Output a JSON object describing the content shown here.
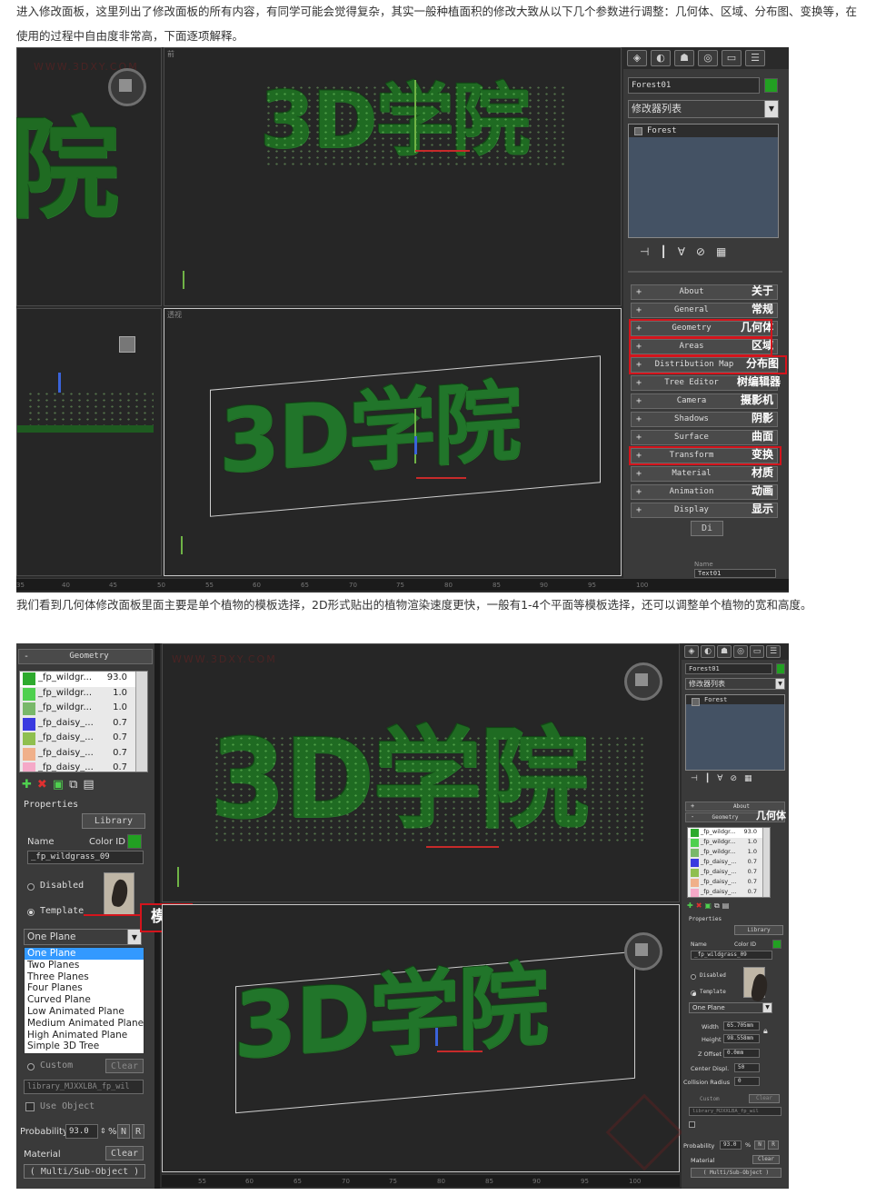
{
  "intro_text": "进入修改面板，这里列出了修改面板的所有内容，有同学可能会觉得复杂，其实一般种植面积的修改大致从以下几个参数进行调整：几何体、区域、分布图、变换等，在使用的过程中自由度非常高，下面逐项解释。",
  "middle_text": "我们看到几何体修改面板里面主要是单个植物的模板选择，2D形式贴出的植物渲染速度更快，一般有1-4个平面等模板选择，还可以调整单个植物的宽和高度。",
  "scene_text": "3D学院",
  "watermark": "WWW.3DXY.COM",
  "colors": {
    "foliage": "#1f6b22",
    "highlight": "#d4141c",
    "panel": "#3a3a3a",
    "selection": "#3399ff"
  },
  "shot1": {
    "viewport_labels": {
      "top_right": "前",
      "bottom_right": "透视"
    },
    "panel_tabs": [
      "create-icon",
      "modify-icon",
      "hierarchy-icon",
      "motion-icon",
      "display-icon",
      "utilities-icon"
    ],
    "object_name": "Forest01",
    "modifier_list": "修改器列表",
    "stack_item": "Forest",
    "stack_tools": [
      "pin-icon",
      "show-end-icon",
      "make-unique-icon",
      "remove-modifier-icon",
      "configure-icon"
    ],
    "rollouts": [
      {
        "label": "About",
        "cn": "关于",
        "highlight": false
      },
      {
        "label": "General",
        "cn": "常规",
        "highlight": false
      },
      {
        "label": "Geometry",
        "cn": "几何体",
        "highlight": true
      },
      {
        "label": "Areas",
        "cn": "区域",
        "highlight": true
      },
      {
        "label": "Distribution Map",
        "cn": "分布图",
        "highlight": true
      },
      {
        "label": "Tree Editor",
        "cn": "树编辑器",
        "highlight": false
      },
      {
        "label": "Camera",
        "cn": "摄影机",
        "highlight": false
      },
      {
        "label": "Shadows",
        "cn": "阴影",
        "highlight": false
      },
      {
        "label": "Surface",
        "cn": "曲面",
        "highlight": false
      },
      {
        "label": "Transform",
        "cn": "变换",
        "highlight": true
      },
      {
        "label": "Material",
        "cn": "材质",
        "highlight": false
      },
      {
        "label": "Animation",
        "cn": "动画",
        "highlight": false
      },
      {
        "label": "Display",
        "cn": "显示",
        "highlight": false
      }
    ],
    "last_rollout_partial": "Di",
    "name_label": "Name",
    "name_value": "Text01",
    "ruler_ticks": [
      "35",
      "40",
      "45",
      "50",
      "55",
      "60",
      "65",
      "70",
      "75",
      "80",
      "85",
      "90",
      "95",
      "100"
    ]
  },
  "shot2": {
    "rollout_title": "Geometry",
    "plants": [
      {
        "name": "_fp_wildgr...",
        "value": "93.0",
        "color": "#2eaa2e"
      },
      {
        "name": "_fp_wildgr...",
        "value": "1.0",
        "color": "#4fd04f"
      },
      {
        "name": "_fp_wildgr...",
        "value": "1.0",
        "color": "#79b86a"
      },
      {
        "name": "_fp_daisy_...",
        "value": "0.7",
        "color": "#3a3ae0"
      },
      {
        "name": "_fp_daisy_...",
        "value": "0.7",
        "color": "#8fbf4f"
      },
      {
        "name": "_fp_daisy_...",
        "value": "0.7",
        "color": "#f0b08a"
      },
      {
        "name": "_fp_daisy_...",
        "value": "0.7",
        "color": "#f5a9c8"
      }
    ],
    "list_tools": [
      "add-icon",
      "delete-icon",
      "add-object-icon",
      "copy-icon",
      "paste-icon"
    ],
    "properties_label": "Properties",
    "library_button": "Library",
    "name_label": "Name",
    "color_id_label": "Color ID",
    "name_value": "_fp_wildgrass_09",
    "disabled_label": "Disabled",
    "template_label": "Template",
    "callout": "模板",
    "template_selected": "One Plane",
    "template_options": [
      "One Plane",
      "Two Planes",
      "Three Planes",
      "Four Planes",
      "Curved Plane",
      "Low Animated Plane",
      "Medium Animated Plane",
      "High Animated Plane",
      "Simple 3D Tree"
    ],
    "custom_label": "Custom",
    "clear_label": "Clear",
    "library_path": "library_MJXXLBA_fp_wil",
    "use_object_label": "Use Object",
    "probability_label": "Probability",
    "probability_value": "93.0",
    "percent_suffix": "%",
    "n_label": "N",
    "r_label": "R",
    "material_label": "Material",
    "material_value": "( Multi/Sub-Object )",
    "right_panel": {
      "object_name": "Forest01",
      "modifier_list": "修改器列表",
      "stack_item": "Forest",
      "rollout_about": "About",
      "rollout_geometry": "Geometry",
      "geometry_cn": "几何体",
      "width_label": "Width",
      "width_value": "65.705mm",
      "height_label": "Height",
      "height_value": "98.558mm",
      "zoffset_label": "Z Offset",
      "zoffset_value": "0.0mm",
      "centerdisp_label": "Center Displ.",
      "centerdisp_value": "50",
      "collision_label": "Collision Radius",
      "collision_value": "0"
    },
    "ruler_ticks": [
      "55",
      "60",
      "65",
      "70",
      "75",
      "80",
      "85",
      "90",
      "95",
      "100"
    ]
  }
}
